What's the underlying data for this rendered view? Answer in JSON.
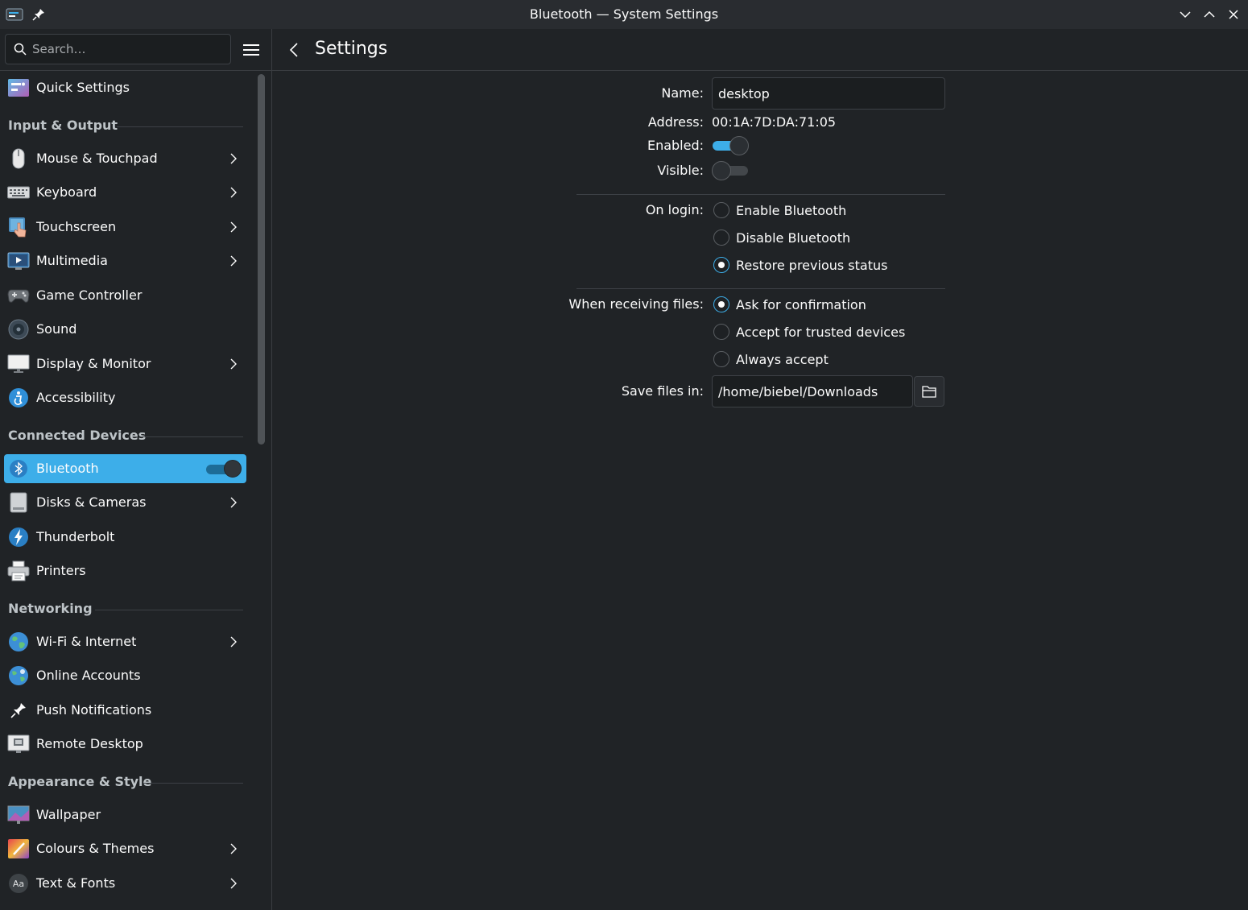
{
  "window": {
    "title": "Bluetooth — System Settings"
  },
  "search": {
    "placeholder": "Search…"
  },
  "header": {
    "page_title": "Settings"
  },
  "sidebar": {
    "quick_settings": "Quick Settings",
    "sections": {
      "input_output": "Input & Output",
      "connected_devices": "Connected Devices",
      "networking": "Networking",
      "appearance_style": "Appearance & Style"
    },
    "items": {
      "mouse_touchpad": "Mouse & Touchpad",
      "keyboard": "Keyboard",
      "touchscreen": "Touchscreen",
      "multimedia": "Multimedia",
      "game_controller": "Game Controller",
      "sound": "Sound",
      "display_monitor": "Display & Monitor",
      "accessibility": "Accessibility",
      "bluetooth": "Bluetooth",
      "disks_cameras": "Disks & Cameras",
      "thunderbolt": "Thunderbolt",
      "printers": "Printers",
      "wifi_internet": "Wi-Fi & Internet",
      "online_accounts": "Online Accounts",
      "push_notifications": "Push Notifications",
      "remote_desktop": "Remote Desktop",
      "wallpaper": "Wallpaper",
      "colours_themes": "Colours & Themes",
      "text_fonts": "Text & Fonts"
    },
    "bluetooth_enabled": true
  },
  "form": {
    "name_label": "Name:",
    "name_value": "desktop",
    "address_label": "Address:",
    "address_value": "00:1A:7D:DA:71:05",
    "enabled_label": "Enabled:",
    "enabled": true,
    "visible_label": "Visible:",
    "visible": false,
    "on_login_label": "On login:",
    "on_login_options": [
      "Enable Bluetooth",
      "Disable Bluetooth",
      "Restore previous status"
    ],
    "on_login_selected": "Restore previous status",
    "receiving_label": "When receiving files:",
    "receiving_options": [
      "Ask for confirmation",
      "Accept for trusted devices",
      "Always accept"
    ],
    "receiving_selected": "Ask for confirmation",
    "save_label": "Save files in:",
    "save_path": "/home/biebel/Downloads"
  },
  "colors": {
    "accent": "#3daee9",
    "background": "#202326",
    "titlebar": "#292c30"
  }
}
